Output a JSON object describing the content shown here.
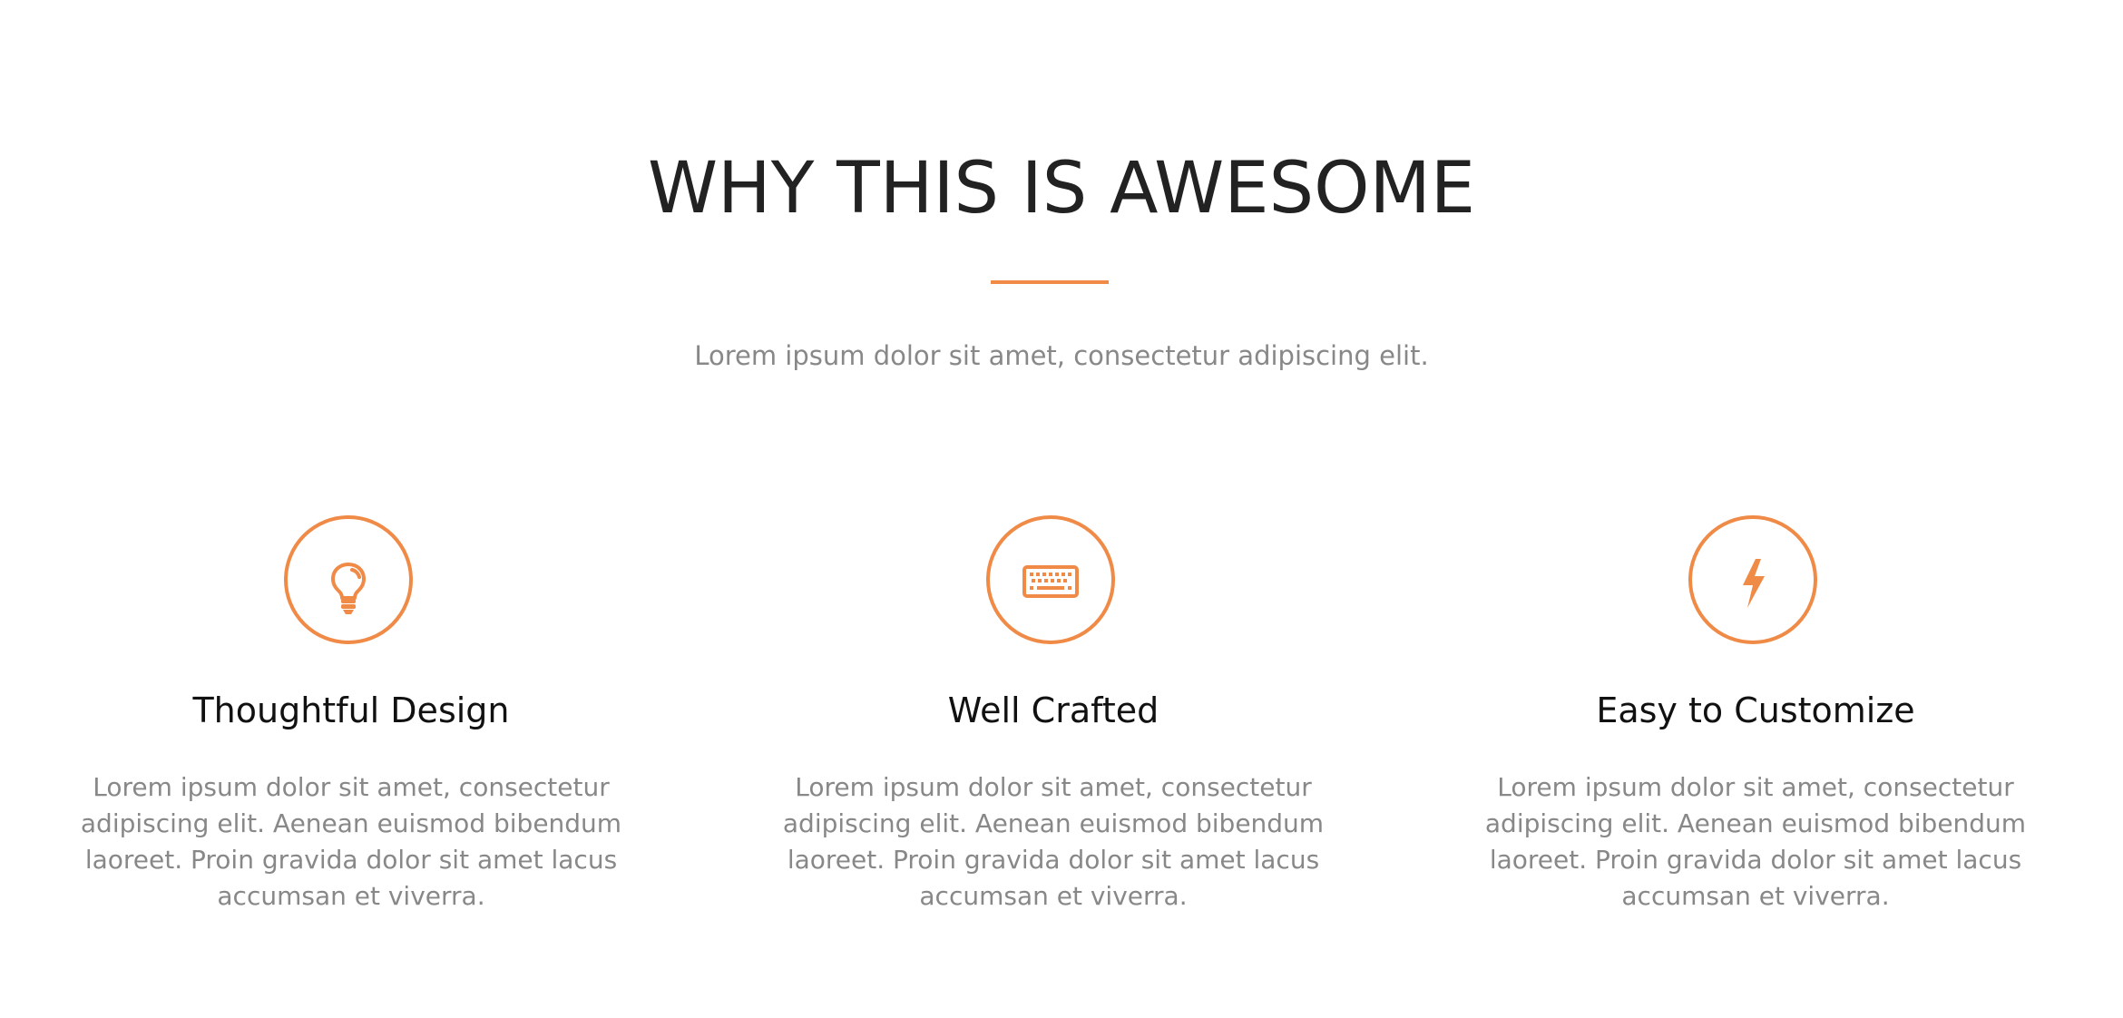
{
  "header": {
    "title": "WHY THIS IS AWESOME",
    "subtitle": "Lorem ipsum dolor sit amet, consectetur adipiscing elit."
  },
  "colors": {
    "accent": "#f08a47",
    "heading": "#222222",
    "body_text": "#888888"
  },
  "features": [
    {
      "icon": "lightbulb-icon",
      "title": "Thoughtful Design",
      "text": "Lorem ipsum dolor sit amet, consectetur adipiscing elit. Aenean euismod bibendum laoreet. Proin gravida dolor sit amet lacus accumsan et viverra."
    },
    {
      "icon": "keyboard-icon",
      "title": "Well Crafted",
      "text": "Lorem ipsum dolor sit amet, consectetur adipiscing elit. Aenean euismod bibendum laoreet. Proin gravida dolor sit amet lacus accumsan et viverra."
    },
    {
      "icon": "lightning-bolt-icon",
      "title": "Easy to Customize",
      "text": "Lorem ipsum dolor sit amet, consectetur adipiscing elit. Aenean euismod bibendum laoreet. Proin gravida dolor sit amet lacus accumsan et viverra."
    }
  ]
}
